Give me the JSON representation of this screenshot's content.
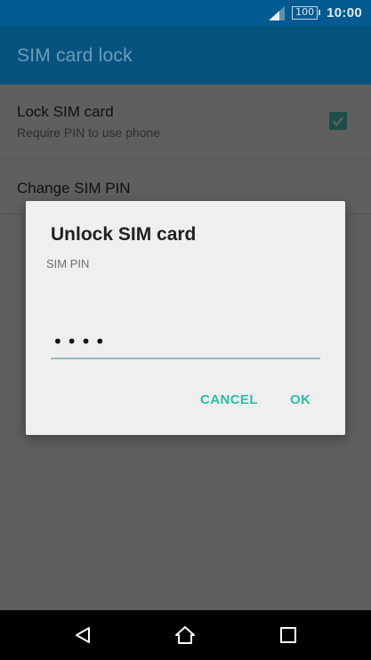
{
  "status_bar": {
    "battery": "100",
    "time": "10:00",
    "icons": [
      "signal-icon",
      "battery-icon"
    ]
  },
  "action_bar": {
    "title": "SIM card lock"
  },
  "settings": {
    "lock_sim": {
      "title": "Lock SIM card",
      "summary": "Require PIN to use phone",
      "checked": true
    },
    "change_pin": {
      "title": "Change SIM PIN"
    }
  },
  "dialog": {
    "title": "Unlock SIM card",
    "label": "SIM PIN",
    "pin_value": "••••",
    "cancel_label": "CANCEL",
    "ok_label": "OK"
  },
  "nav_bar": {
    "icons": [
      "back-icon",
      "home-icon",
      "recent-apps-icon"
    ]
  },
  "colors": {
    "status_bar": "#035a90",
    "action_bar": "#06537f",
    "accent": "#2bbfa8",
    "dim_background": "#5f5f5f"
  }
}
